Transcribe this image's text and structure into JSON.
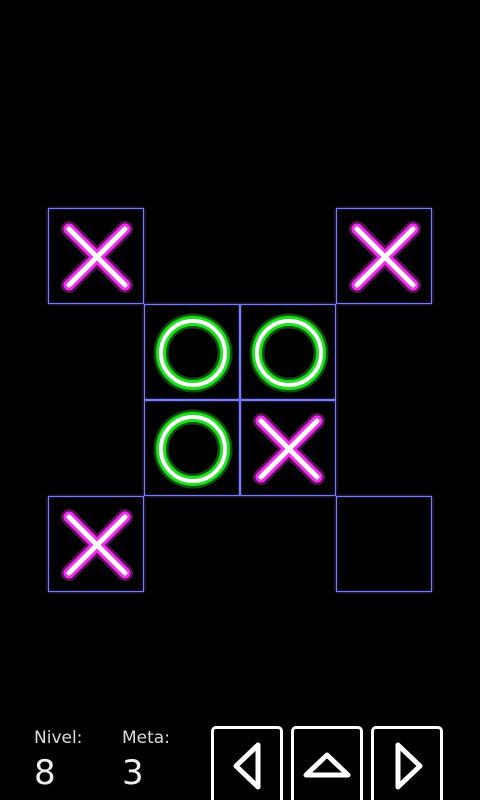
{
  "board": {
    "cells": [
      {
        "row": 0,
        "col": 0,
        "mark": "X"
      },
      {
        "row": 0,
        "col": 3,
        "mark": "X"
      },
      {
        "row": 1,
        "col": 1,
        "mark": "O"
      },
      {
        "row": 1,
        "col": 2,
        "mark": "O"
      },
      {
        "row": 2,
        "col": 1,
        "mark": "O"
      },
      {
        "row": 2,
        "col": 2,
        "mark": "X"
      },
      {
        "row": 3,
        "col": 0,
        "mark": "X"
      },
      {
        "row": 3,
        "col": 3,
        "mark": ""
      }
    ],
    "colors": {
      "grid": "#7b7bff",
      "x_glow": "#ff33ff",
      "o_glow": "#22ee22",
      "core": "#ffffff"
    }
  },
  "status": {
    "level_label": "Nivel:",
    "level_value": "8",
    "goal_label": "Meta:",
    "goal_value": "3"
  },
  "controls": {
    "prev_icon": "triangle-left-icon",
    "up_icon": "triangle-up-icon",
    "next_icon": "triangle-right-icon"
  }
}
